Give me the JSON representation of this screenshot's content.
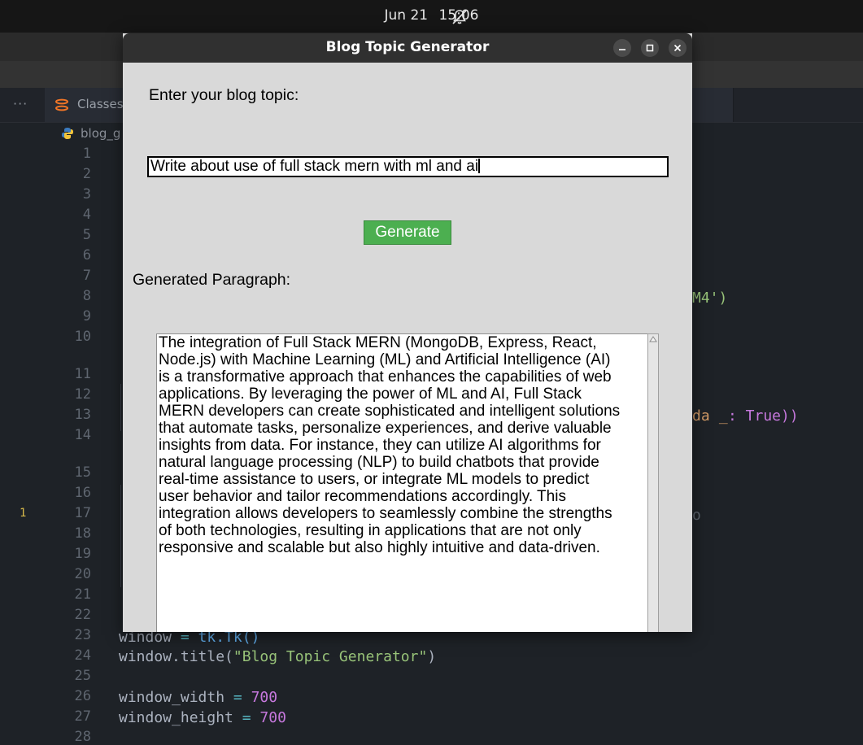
{
  "system_bar": {
    "date": "Jun 21",
    "time": "15:06",
    "notification_icon": "bell-off-icon"
  },
  "editor": {
    "tab_label": "Classes.",
    "breadcrumb_file": "blog_g",
    "line_numbers": [
      "1",
      "2",
      "3",
      "4",
      "5",
      "6",
      "7",
      "8",
      "9",
      "10",
      "11",
      "12",
      "13",
      "14",
      "15",
      "16",
      "17",
      "18",
      "19",
      "20",
      "21",
      "22",
      "23",
      "24",
      "25",
      "26",
      "27",
      "28"
    ],
    "problem_marker": "1",
    "visible_fragments": {
      "line8_tail": "M4')",
      "line13_tail_a": "da",
      "line13_tail_b": " _",
      "line13_tail_c": ": True))",
      "line17_tail": "o"
    },
    "code_lines": {
      "line23": {
        "var": "window",
        "op": " = ",
        "call": "tk.Tk()"
      },
      "line24": {
        "head": "window.title(",
        "str": "\"Blog Topic Generator\"",
        "tail": ")"
      },
      "line26": {
        "var": "window_width",
        "op": " = ",
        "num": "700"
      },
      "line27": {
        "var": "window_height",
        "op": " = ",
        "num": "700"
      }
    }
  },
  "app_window": {
    "title": "Blog Topic Generator",
    "controls": [
      "minimize-icon",
      "maximize-icon",
      "close-icon"
    ],
    "topic_label": "Enter your blog topic:",
    "topic_value": "Write about use of full stack mern with ml and ai",
    "generate_label": "Generate",
    "paragraph_label": "Generated Paragraph:",
    "generated_lines": [
      "The integration of Full Stack MERN (MongoDB, Express, React,",
      "Node.js) with Machine Learning (ML) and Artificial Intelligence (AI)",
      "is a transformative approach that enhances the capabilities of web",
      "applications. By leveraging the power of ML and AI, Full Stack",
      "MERN developers can create sophisticated and intelligent solutions",
      "that automate tasks, personalize experiences, and derive valuable",
      "insights from data. For instance, they can utilize AI algorithms for",
      "natural language processing (NLP) to build chatbots that provide",
      "real-time assistance to users, or integrate ML models to predict",
      "user behavior and tailor recommendations accordingly. This",
      "integration allows developers to seamlessly combine the strengths",
      "of both technologies, resulting in applications that are not only",
      "responsive and scalable but also highly intuitive and data-driven."
    ],
    "colors": {
      "generate_button": "#4caf50",
      "window_bg": "#d9d9d9",
      "titlebar": "#303030"
    }
  }
}
